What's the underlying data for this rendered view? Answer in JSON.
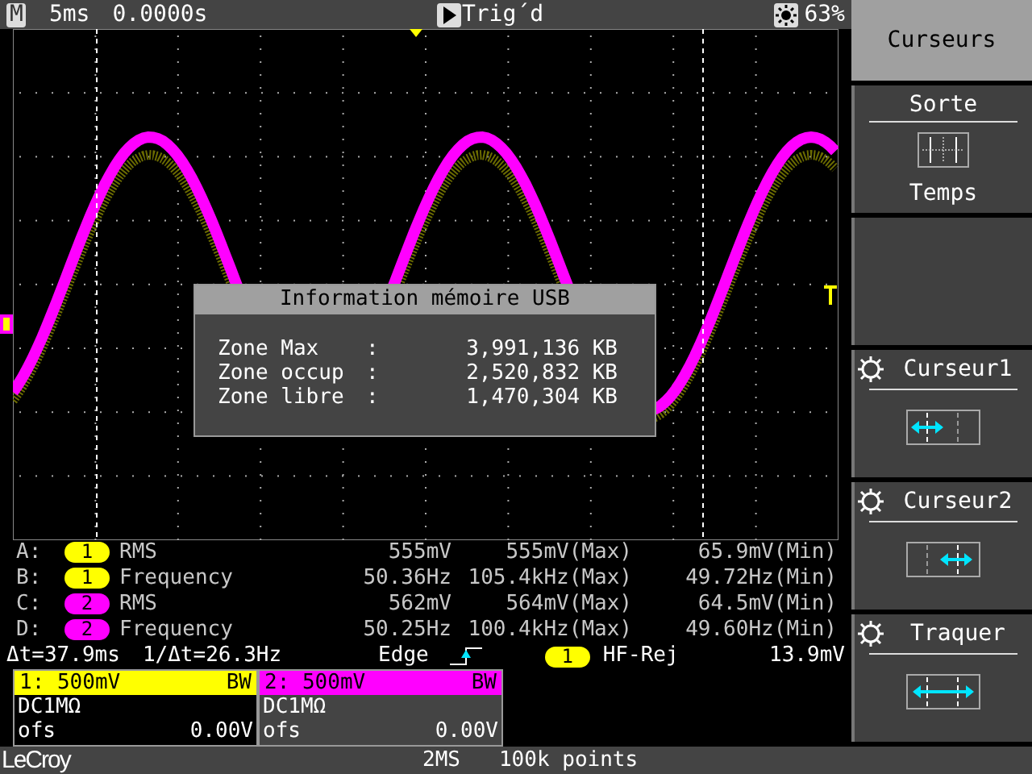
{
  "top_bar": {
    "mode": "M",
    "timebase": "5ms",
    "delay": "0.0000s",
    "trigger_state": "Trig´d",
    "brightness": "63%"
  },
  "dialog": {
    "title": "Information mémoire USB",
    "rows": [
      {
        "label": "Zone Max",
        "colon": ":",
        "value": "3,991,136 KB"
      },
      {
        "label": "Zone occup",
        "colon": ":",
        "value": "2,520,832 KB"
      },
      {
        "label": "Zone libre",
        "colon": ":",
        "value": "1,470,304 KB"
      }
    ]
  },
  "measurements": [
    {
      "slot": "A:",
      "channel": "1",
      "color": "#ffff00",
      "parameter": "RMS",
      "value": "555mV",
      "max": "555mV(Max)",
      "min": "65.9mV(Min)"
    },
    {
      "slot": "B:",
      "channel": "1",
      "color": "#ffff00",
      "parameter": "Frequency",
      "value": "50.36Hz",
      "max": "105.4kHz(Max)",
      "min": "49.72Hz(Min)"
    },
    {
      "slot": "C:",
      "channel": "2",
      "color": "#ff00ff",
      "parameter": "RMS",
      "value": "562mV",
      "max": "564mV(Max)",
      "min": "64.5mV(Min)"
    },
    {
      "slot": "D:",
      "channel": "2",
      "color": "#ff00ff",
      "parameter": "Frequency",
      "value": "50.25Hz",
      "max": "100.4kHz(Max)",
      "min": "49.60Hz(Min)"
    }
  ],
  "cursor_readout": {
    "delta_t": "Δt=37.9ms",
    "inverse_delta_t": "1/Δt=26.3Hz"
  },
  "trigger": {
    "type": "Edge",
    "channel": "1",
    "color": "#ffff00",
    "coupling": "HF-Rej",
    "threshold": "13.9mV"
  },
  "channels": [
    {
      "scale": "1: 500mV",
      "bandwidth": "BW",
      "color": "#ffff00",
      "coupling": "DC1MΩ",
      "offset_label": "ofs",
      "offset": "0.00V",
      "selected": true
    },
    {
      "scale": "2: 500mV",
      "bandwidth": "BW",
      "color": "#ff00ff",
      "coupling": "DC1MΩ",
      "offset_label": "ofs",
      "offset": "0.00V",
      "selected": false
    }
  ],
  "bottom_bar": {
    "logo": "LeCroy",
    "sample_rate": "2MS",
    "record_length": "100k points"
  },
  "menu": {
    "title": "Curseurs",
    "items": [
      {
        "kind": "option",
        "label": "Sorte",
        "value": "Temps"
      },
      {
        "kind": "blank"
      },
      {
        "kind": "leftcursor",
        "label": "Curseur1"
      },
      {
        "kind": "rightcursor",
        "label": "Curseur2"
      },
      {
        "kind": "bothcursors",
        "label": "Traquer"
      }
    ]
  }
}
